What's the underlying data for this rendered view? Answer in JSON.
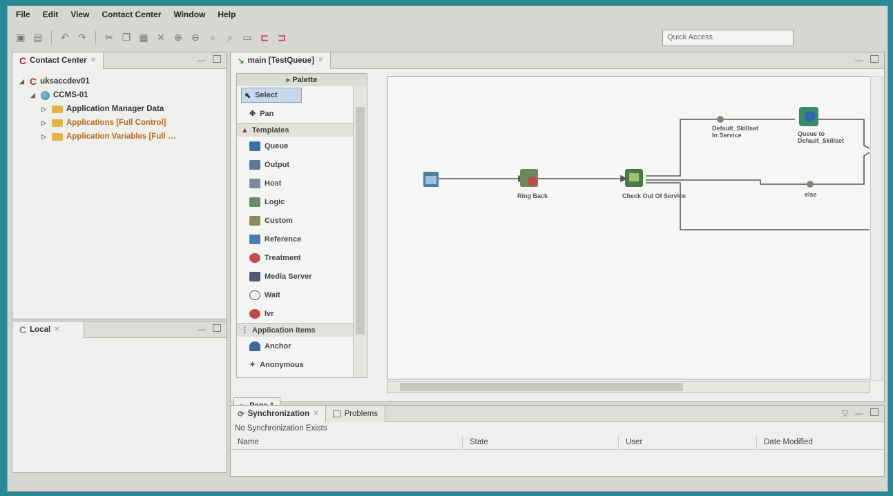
{
  "menu": [
    "File",
    "Edit",
    "View",
    "Contact Center",
    "Window",
    "Help"
  ],
  "quick_access": "Quick Access",
  "contact_center": {
    "tab": "Contact Center",
    "server": "uksaccdev01",
    "node": "CCMS-01",
    "folders": [
      "Application Manager Data",
      "Applications [Full Control]",
      "Application Variables [Full …"
    ]
  },
  "local": {
    "tab": "Local"
  },
  "editor": {
    "tab": "main [TestQueue]",
    "palette_title": "Palette",
    "tools": [
      "Select",
      "Pan"
    ],
    "templates_label": "Templates",
    "templates": [
      "Queue",
      "Output",
      "Host",
      "Logic",
      "Custom",
      "Reference",
      "Treatment",
      "Media Server",
      "Wait",
      "Ivr"
    ],
    "app_items_label": "Application Items",
    "app_items": [
      "Anchor",
      "Anonymous"
    ],
    "page_tab": "Page 1"
  },
  "flow": {
    "nodes": [
      "Ring Back",
      "Check Out Of Service",
      "Default_Skillset In Service",
      "Queue to Default_Skillset",
      "else"
    ]
  },
  "sync": {
    "tab": "Synchronization",
    "tab2": "Problems",
    "status": "No Synchronization Exists",
    "columns": [
      "Name",
      "State",
      "User",
      "Date Modified"
    ]
  },
  "colors": {
    "accent": "#2a8a94",
    "selection": "#c7d8ea"
  }
}
